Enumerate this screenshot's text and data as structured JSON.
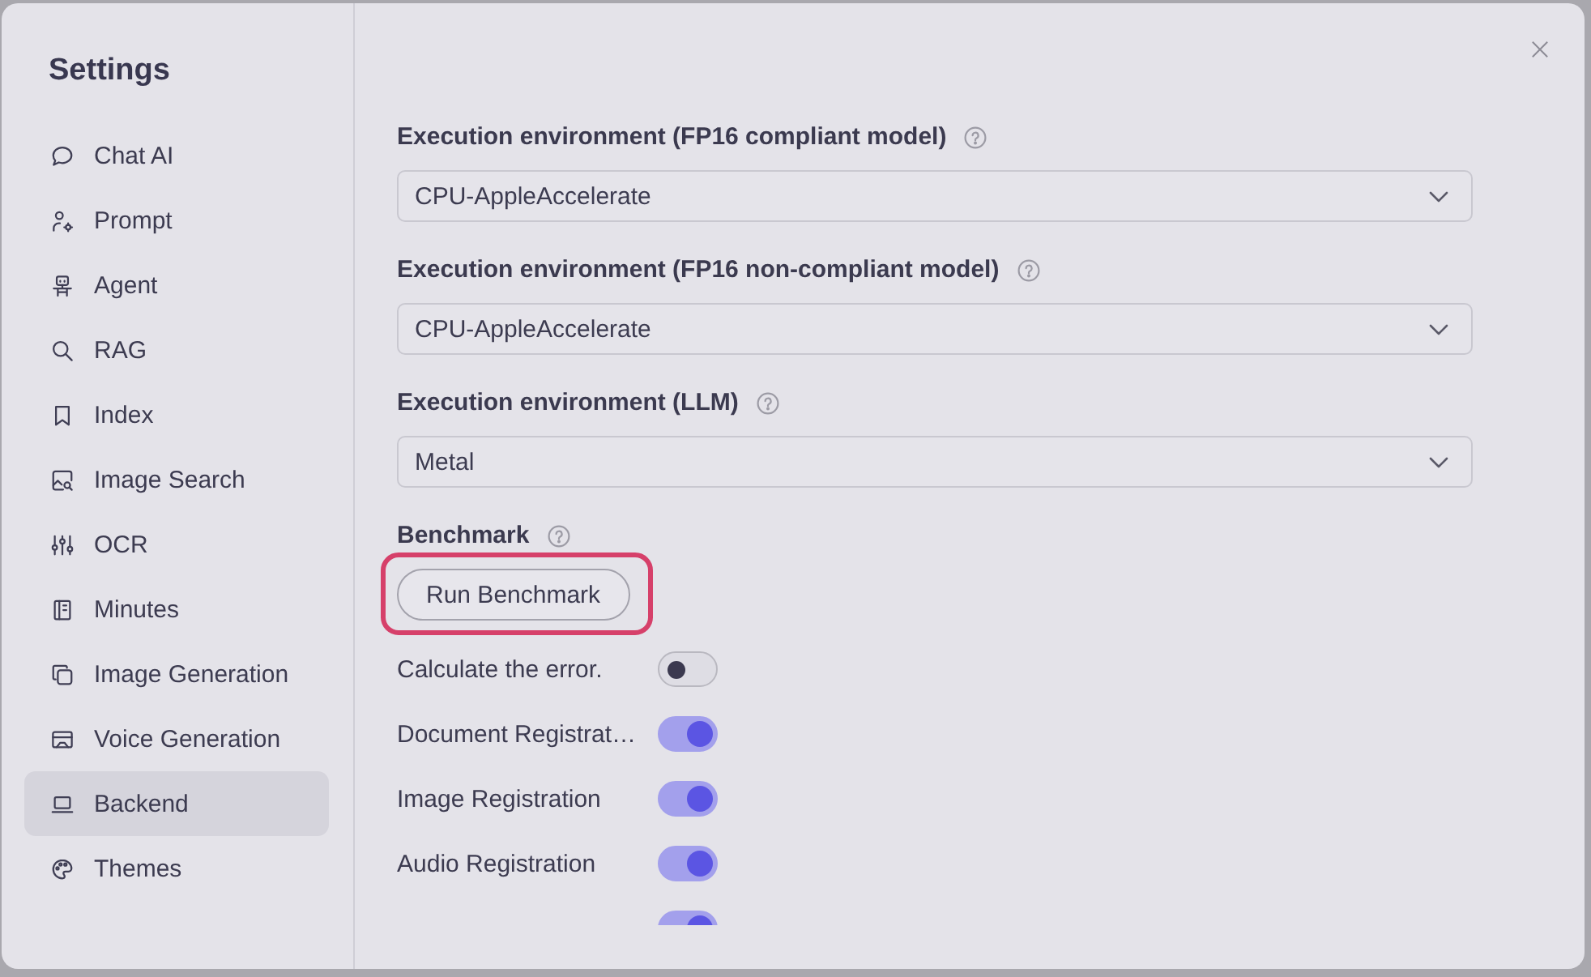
{
  "sidebar": {
    "title": "Settings",
    "items": [
      {
        "label": "Chat AI",
        "selected": false
      },
      {
        "label": "Prompt",
        "selected": false
      },
      {
        "label": "Agent",
        "selected": false
      },
      {
        "label": "RAG",
        "selected": false
      },
      {
        "label": "Index",
        "selected": false
      },
      {
        "label": "Image Search",
        "selected": false
      },
      {
        "label": "OCR",
        "selected": false
      },
      {
        "label": "Minutes",
        "selected": false
      },
      {
        "label": "Image Generation",
        "selected": false
      },
      {
        "label": "Voice Generation",
        "selected": false
      },
      {
        "label": "Backend",
        "selected": true
      },
      {
        "label": "Themes",
        "selected": false
      }
    ]
  },
  "settings": {
    "selects": [
      {
        "label": "Execution environment (FP16 compliant model)",
        "value": "CPU-AppleAccelerate"
      },
      {
        "label": "Execution environment (FP16 non-compliant model)",
        "value": "CPU-AppleAccelerate"
      },
      {
        "label": "Execution environment (LLM)",
        "value": "Metal"
      }
    ],
    "benchmark": {
      "label": "Benchmark",
      "button": "Run Benchmark",
      "highlighted": true
    },
    "toggles": [
      {
        "label": "Calculate the error.",
        "checked": false
      },
      {
        "label": "Document Registrat…",
        "checked": true
      },
      {
        "label": "Image Registration",
        "checked": true
      },
      {
        "label": "Audio Registration",
        "checked": true
      },
      {
        "checked": true
      }
    ]
  }
}
